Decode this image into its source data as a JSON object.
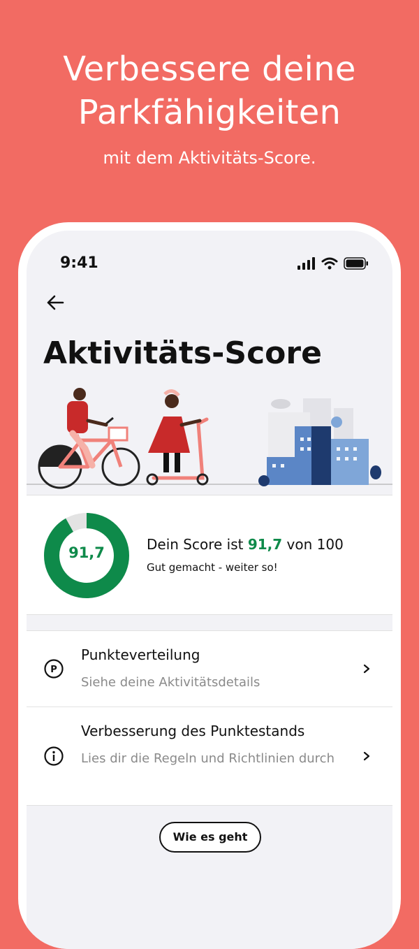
{
  "promo": {
    "title": "Verbessere deine\nParkfähigkeiten",
    "subtitle": "mit dem Aktivitäts-Score."
  },
  "status_bar": {
    "time": "9:41",
    "icons": [
      "signal-icon",
      "wifi-icon",
      "battery-icon"
    ]
  },
  "header": {
    "back_icon": "arrow-left-icon",
    "title": "Aktivitäts-Score"
  },
  "score": {
    "value": "91,7",
    "prefix": "Dein Score ist ",
    "value_text": "91,7",
    "suffix": " von 100",
    "message": "Gut gemacht - weiter so!",
    "fraction": 0.917,
    "accent_color": "#0E8A4A"
  },
  "menu": {
    "items": [
      {
        "icon": "parking-icon",
        "title": "Punkteverteilung",
        "subtitle": "Siehe deine Aktivitätsdetails"
      },
      {
        "icon": "info-icon",
        "title": "Verbesserung des Punktestands",
        "subtitle": "Lies dir die Regeln und Richtlinien durch"
      }
    ]
  },
  "how_button": {
    "label": "Wie es geht"
  },
  "colors": {
    "background": "#F26B63",
    "accent": "#0E8A4A"
  }
}
